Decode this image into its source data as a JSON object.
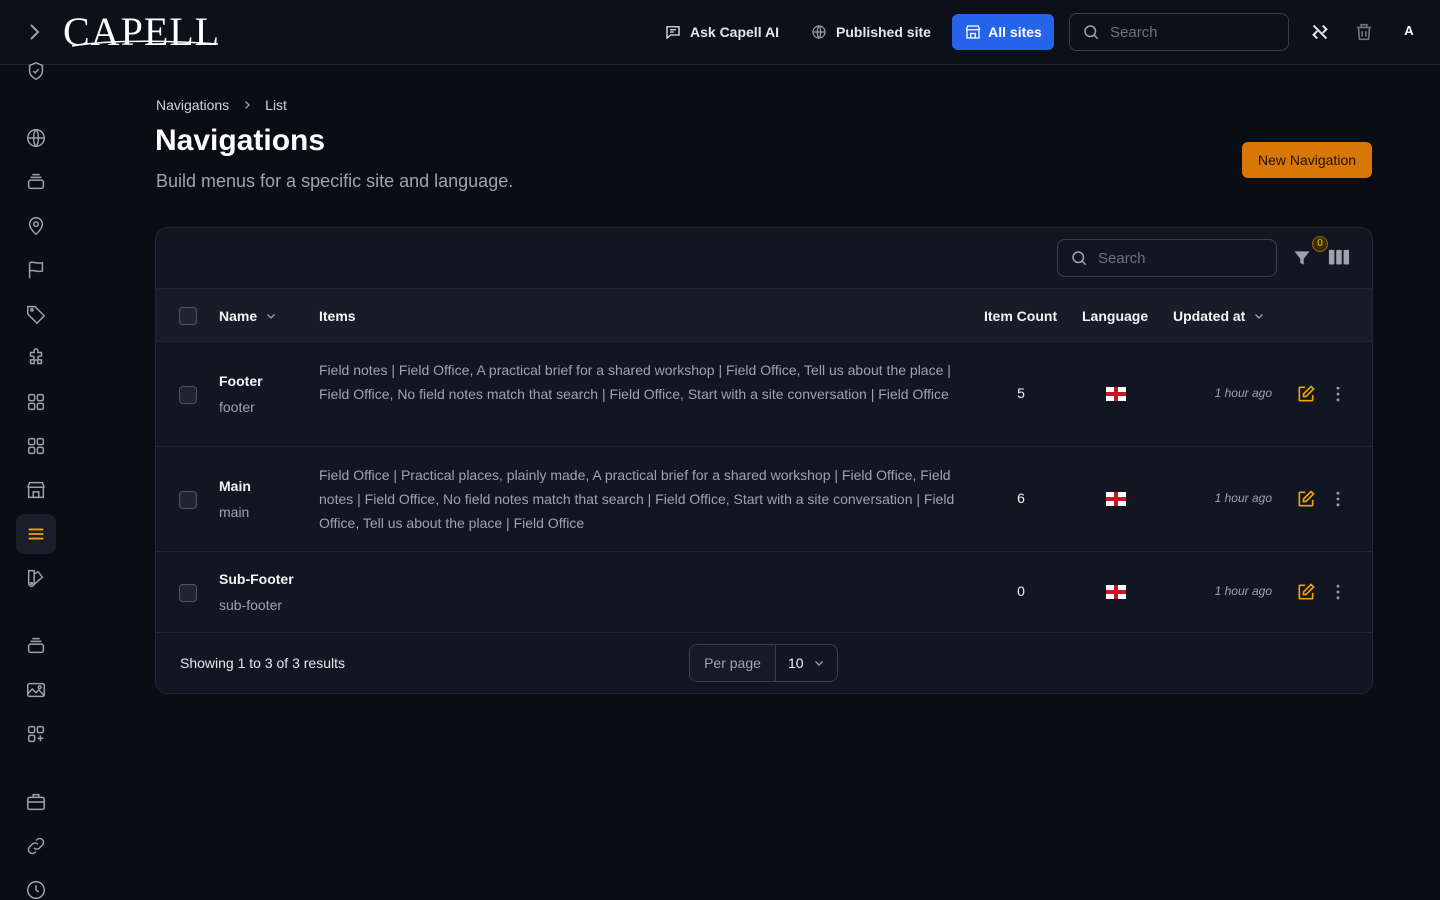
{
  "app": {
    "logo_text": "CAPELL"
  },
  "topbar": {
    "ask_ai_label": "Ask Capell AI",
    "published_site_label": "Published site",
    "all_sites_label": "All sites",
    "search_placeholder": "Search",
    "avatar_initial": "A"
  },
  "breadcrumb": {
    "items": [
      "Navigations",
      "List"
    ]
  },
  "page": {
    "title": "Navigations",
    "subtitle": "Build menus for a specific site and language.",
    "new_button_label": "New Navigation"
  },
  "table": {
    "search_placeholder": "Search",
    "filter_count": "0",
    "columns": {
      "name": "Name",
      "items": "Items",
      "item_count": "Item Count",
      "language": "Language",
      "updated_at": "Updated at"
    },
    "rows": [
      {
        "name": "Footer",
        "slug": "footer",
        "items": "Field notes | Field Office, A practical brief for a shared workshop | Field Office, Tell us about the place | Field Office, No field notes match that search | Field Office, Start with a site conversation | Field Office",
        "item_count": "5",
        "language": "English",
        "updated_at": "1 hour ago"
      },
      {
        "name": "Main",
        "slug": "main",
        "items": "Field Office | Practical places, plainly made, A practical brief for a shared workshop | Field Office, Field notes | Field Office, No field notes match that search | Field Office, Start with a site conversation | Field Office, Tell us about the place | Field Office",
        "item_count": "6",
        "language": "English",
        "updated_at": "1 hour ago"
      },
      {
        "name": "Sub-Footer",
        "slug": "sub-footer",
        "items": "",
        "item_count": "0",
        "language": "English",
        "updated_at": "1 hour ago"
      }
    ],
    "footer": {
      "showing_text": "Showing 1 to 3 of 3 results",
      "per_page_label": "Per page",
      "per_page_value": "10"
    }
  },
  "sidebar": {
    "icons": [
      "shield-check-icon",
      "globe-icon",
      "stack-icon",
      "map-pin-icon",
      "flag-icon",
      "tag-icon",
      "puzzle-icon",
      "squares-icon",
      "squares-icon",
      "building-icon",
      "menu-lines-icon",
      "swatch-icon",
      "stack-icon",
      "image-icon",
      "squares-plus-icon",
      "briefcase-icon",
      "link-icon",
      "clock-icon"
    ],
    "active": "menu-lines-icon"
  },
  "colors": {
    "accent": "#f59e0b",
    "primary": "#2563eb",
    "background": "#0a0d14",
    "card": "#111623"
  }
}
